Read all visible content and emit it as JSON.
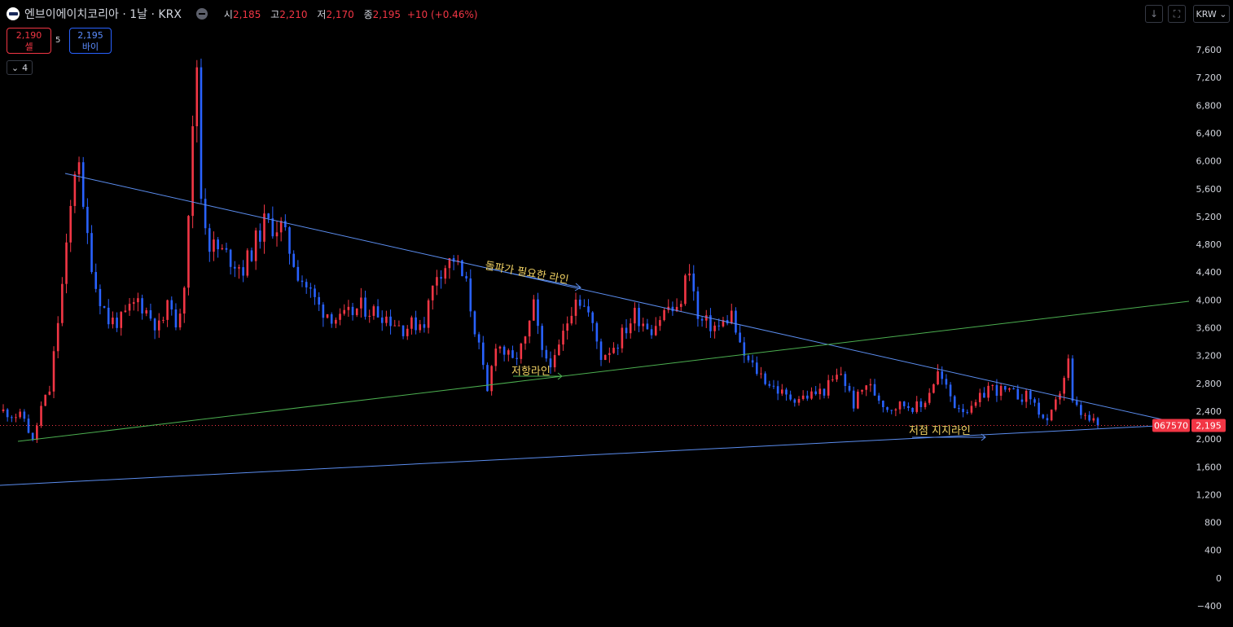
{
  "header": {
    "title": "엔브이에이치코리아 · 1날 · KRX",
    "open_label": "시",
    "open": "2,185",
    "high_label": "고",
    "high": "2,210",
    "low_label": "저",
    "low": "2,170",
    "close_label": "종",
    "close": "2,195",
    "change": "+10 (+0.46%)"
  },
  "trade": {
    "sell_price": "2,190",
    "sell_label": "셀",
    "spread": "5",
    "buy_price": "2,195",
    "buy_label": "바이"
  },
  "legend_toggle": {
    "count": "4"
  },
  "toolbar": {
    "currency": "KRW"
  },
  "price_axis": {
    "labels": [
      "7,600",
      "7,200",
      "6,800",
      "6,400",
      "6,000",
      "5,600",
      "5,200",
      "4,800",
      "4,400",
      "4,000",
      "3,600",
      "3,200",
      "2,800",
      "2,400",
      "2,000",
      "1,600",
      "1,200",
      "800",
      "400",
      "0",
      "−400"
    ],
    "symbol_tag": "067570",
    "last_price_tag": "2,195"
  },
  "colors": {
    "up": "#f23645",
    "down": "#2962ff",
    "resistance": "#5b8def",
    "green_line": "#4caf50",
    "annotation": "#f5d565",
    "background": "#000000"
  },
  "annotations": [
    "돌파가 필요한 라인",
    "저항라인",
    "저점 지지라인"
  ],
  "chart_data": {
    "type": "candlestick",
    "title": "엔브이에이치코리아 · 1날 · KRX",
    "y_unit": "KRW",
    "ylim": [
      -400,
      7600
    ],
    "grid": false,
    "last_close": 2195,
    "approx_price_path": [
      [
        0,
        2400
      ],
      [
        5,
        2300
      ],
      [
        7,
        1950
      ],
      [
        9,
        2450
      ],
      [
        11,
        2700
      ],
      [
        13,
        3700
      ],
      [
        15,
        4700
      ],
      [
        17,
        5900
      ],
      [
        18,
        6100
      ],
      [
        19,
        5200
      ],
      [
        20,
        4900
      ],
      [
        22,
        4200
      ],
      [
        25,
        3700
      ],
      [
        28,
        3700
      ],
      [
        32,
        4000
      ],
      [
        37,
        3600
      ],
      [
        40,
        4000
      ],
      [
        41,
        3500
      ],
      [
        43,
        4300
      ],
      [
        46,
        7400
      ],
      [
        47,
        5500
      ],
      [
        49,
        4800
      ],
      [
        54,
        4600
      ],
      [
        57,
        4450
      ],
      [
        62,
        5100
      ],
      [
        66,
        5050
      ],
      [
        70,
        4400
      ],
      [
        75,
        3900
      ],
      [
        80,
        3700
      ],
      [
        85,
        3900
      ],
      [
        90,
        3800
      ],
      [
        95,
        3600
      ],
      [
        100,
        3700
      ],
      [
        103,
        4400
      ],
      [
        107,
        4600
      ],
      [
        110,
        4200
      ],
      [
        113,
        3300
      ],
      [
        115,
        2650
      ],
      [
        117,
        3400
      ],
      [
        121,
        3100
      ],
      [
        124,
        3400
      ],
      [
        126,
        3900
      ],
      [
        128,
        3200
      ],
      [
        131,
        3100
      ],
      [
        133,
        3500
      ],
      [
        136,
        4100
      ],
      [
        139,
        3800
      ],
      [
        142,
        3200
      ],
      [
        146,
        3400
      ],
      [
        150,
        3800
      ],
      [
        154,
        3600
      ],
      [
        158,
        3900
      ],
      [
        160,
        3800
      ],
      [
        163,
        4500
      ],
      [
        165,
        3700
      ],
      [
        170,
        3600
      ],
      [
        173,
        3800
      ],
      [
        175,
        3300
      ],
      [
        177,
        3100
      ],
      [
        182,
        2800
      ],
      [
        186,
        2600
      ],
      [
        190,
        2600
      ],
      [
        195,
        2700
      ],
      [
        199,
        2950
      ],
      [
        202,
        2500
      ],
      [
        205,
        2800
      ],
      [
        210,
        2450
      ],
      [
        214,
        2500
      ],
      [
        218,
        2450
      ],
      [
        222,
        2950
      ],
      [
        226,
        2500
      ],
      [
        230,
        2400
      ],
      [
        234,
        2750
      ],
      [
        239,
        2650
      ],
      [
        244,
        2600
      ],
      [
        248,
        2200
      ],
      [
        250,
        2500
      ],
      [
        253,
        3100
      ],
      [
        254,
        2500
      ],
      [
        257,
        2300
      ],
      [
        260,
        2195
      ]
    ]
  }
}
